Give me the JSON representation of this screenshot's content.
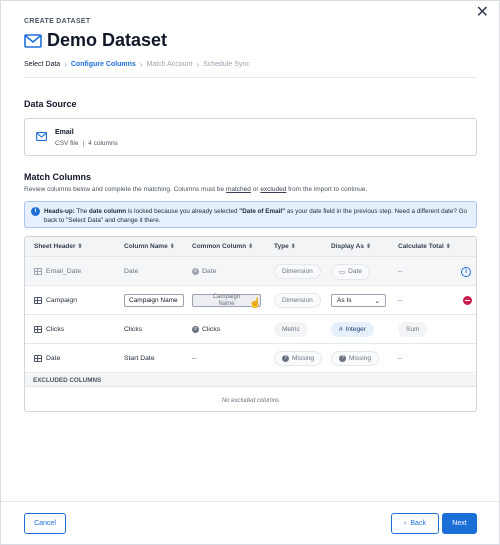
{
  "dialog": {
    "eyebrow": "CREATE DATASET",
    "title": "Demo Dataset",
    "close_label": "✕"
  },
  "steps": [
    {
      "label": "Select Data",
      "state": "done"
    },
    {
      "label": "Configure Columns",
      "state": "active"
    },
    {
      "label": "Match Account",
      "state": "future"
    },
    {
      "label": "Schedule Sync",
      "state": "future"
    }
  ],
  "data_source": {
    "heading": "Data Source",
    "name": "Email",
    "type": "CSV file",
    "separator": "|",
    "columns": "4 columns"
  },
  "match": {
    "heading": "Match Columns",
    "desc_prefix": "Review columns below and complete the matching. Columns must be ",
    "desc_link1": "matched",
    "desc_mid": " or ",
    "desc_link2": "excluded",
    "desc_suffix": " from the import to continue.",
    "info_label": "Heads-up:",
    "info_pre": " The ",
    "info_bold1": "date column",
    "info_mid": " is locked because you already selected ",
    "info_bold2": "\"Date of Email\"",
    "info_post": " as your date field in the previous step. Need a different date? Go back to \"Select Data\" and change it there."
  },
  "table": {
    "headers": [
      "Sheet Header",
      "Column Name",
      "Common Column",
      "Type",
      "Display As",
      "Calculate Total"
    ],
    "rows": [
      {
        "sheet": "Email_Date",
        "column": "Date",
        "common": "Date",
        "type": "Dimension",
        "display": "Date",
        "total": "--"
      },
      {
        "sheet": "Campaign",
        "column": "Campaign Name",
        "common_l1": "Campaign",
        "common_l2": "Name",
        "type": "Dimension",
        "display": "As Is",
        "total": "--"
      },
      {
        "sheet": "Clicks",
        "column": "Clicks",
        "common": "Clicks",
        "type": "Metric",
        "display": "Integer",
        "total": "Sum"
      },
      {
        "sheet": "Date",
        "column": "Start Date",
        "common": "--",
        "type": "Missing",
        "display": "Missing",
        "total": "--"
      }
    ],
    "excluded_heading": "EXCLUDED COLUMNS",
    "excluded_empty": "No excluded columns"
  },
  "footer": {
    "cancel": "Cancel",
    "back": "Back",
    "next": "Next"
  },
  "colors": {
    "accent": "#1d6fd8",
    "danger": "#c81e4a",
    "info_bg": "#e6effc"
  }
}
